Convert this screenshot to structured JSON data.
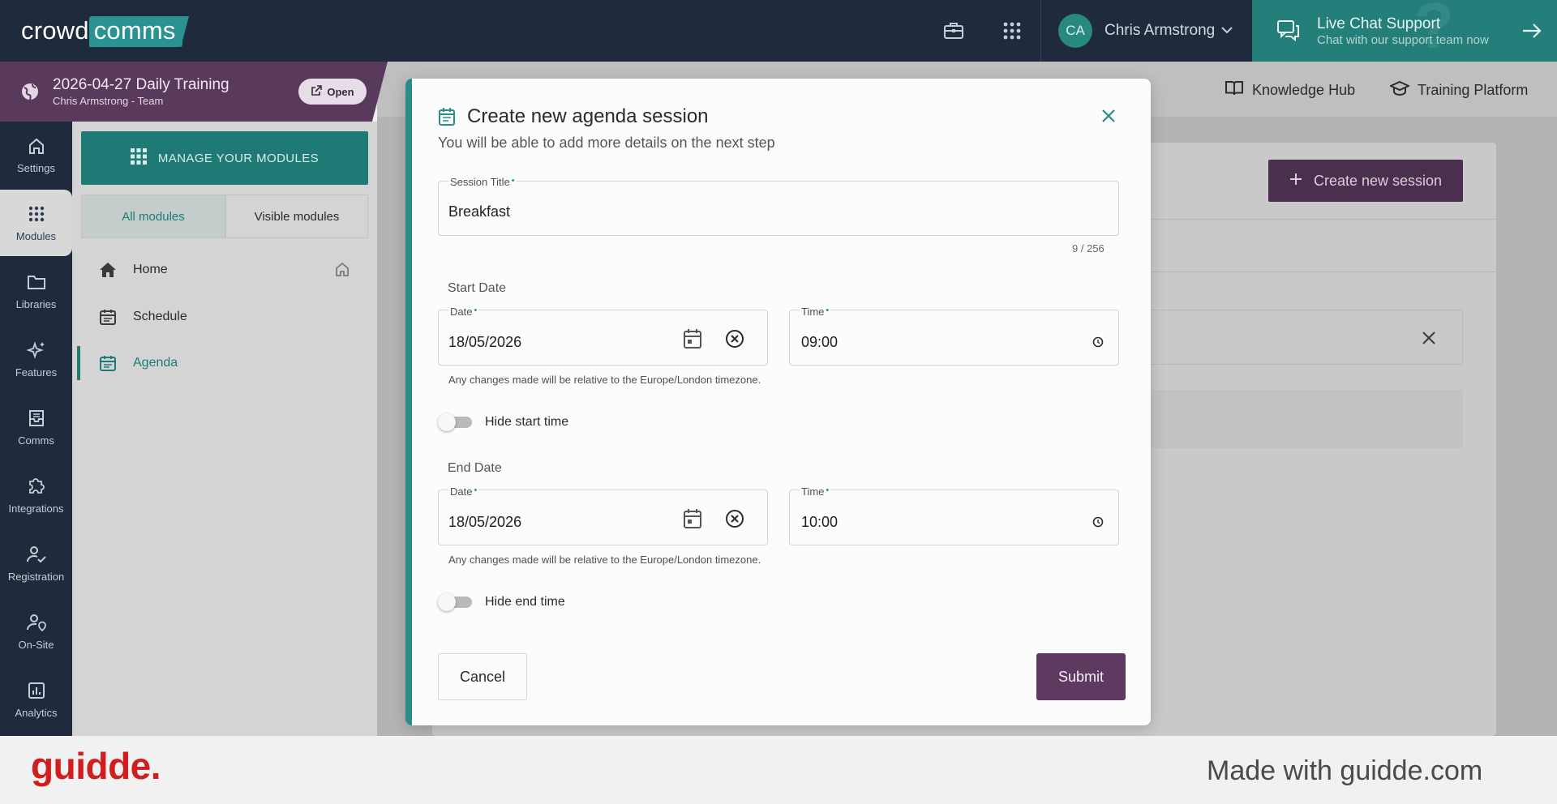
{
  "app": {
    "logo_left": "crowd",
    "logo_right": "comms"
  },
  "topbar": {
    "user_initials": "CA",
    "user_name": "Chris Armstrong",
    "live_chat_title": "Live Chat Support",
    "live_chat_subtitle": "Chat with our support team now"
  },
  "event": {
    "title": "2026-04-27 Daily Training",
    "subtitle": "Chris Armstrong - Team",
    "open_label": "Open"
  },
  "rail": {
    "items": [
      {
        "label": "Settings",
        "icon": "home-icon"
      },
      {
        "label": "Modules",
        "icon": "grid-icon"
      },
      {
        "label": "Libraries",
        "icon": "folder-icon"
      },
      {
        "label": "Features",
        "icon": "sparkles-icon"
      },
      {
        "label": "Comms",
        "icon": "inbox-icon"
      },
      {
        "label": "Integrations",
        "icon": "puzzle-icon"
      },
      {
        "label": "Registration",
        "icon": "user-check-icon"
      },
      {
        "label": "On-Site",
        "icon": "user-pin-icon"
      },
      {
        "label": "Analytics",
        "icon": "bar-chart-icon"
      }
    ],
    "active_index": 1
  },
  "modules": {
    "manage_label": "MANAGE YOUR MODULES",
    "tab_all": "All modules",
    "tab_visible": "Visible modules",
    "items": [
      {
        "label": "Home",
        "icon": "house-icon"
      },
      {
        "label": "Schedule",
        "icon": "calendar-icon"
      },
      {
        "label": "Agenda",
        "icon": "calendar-icon"
      }
    ],
    "active_item": "Agenda"
  },
  "content": {
    "knowledge_hub": "Knowledge Hub",
    "training_platform": "Training Platform",
    "create_session_label": "Create new session"
  },
  "modal": {
    "title": "Create new agenda session",
    "subtitle": "You will be able to add more details on the next step",
    "session_title_label": "Session Title",
    "session_title_value": "Breakfast",
    "char_counter": "9 / 256",
    "start_section": "Start Date",
    "end_section": "End Date",
    "date_label": "Date",
    "time_label": "Time",
    "start_date": "18/05/2026",
    "start_time": "09:00",
    "end_date": "18/05/2026",
    "end_time": "10:00",
    "timezone_helper": "Any changes made will be relative to the Europe/London timezone.",
    "hide_start_label": "Hide start time",
    "hide_end_label": "Hide end time",
    "hide_start_on": false,
    "hide_end_on": false,
    "cancel_label": "Cancel",
    "submit_label": "Submit"
  },
  "footer": {
    "brand": "guidde.",
    "made_with": "Made with guidde.com"
  },
  "colors": {
    "navy": "#1f2a3c",
    "teal": "#2a8d89",
    "plum": "#5e3a60",
    "guidde_red": "#d01d1d"
  }
}
